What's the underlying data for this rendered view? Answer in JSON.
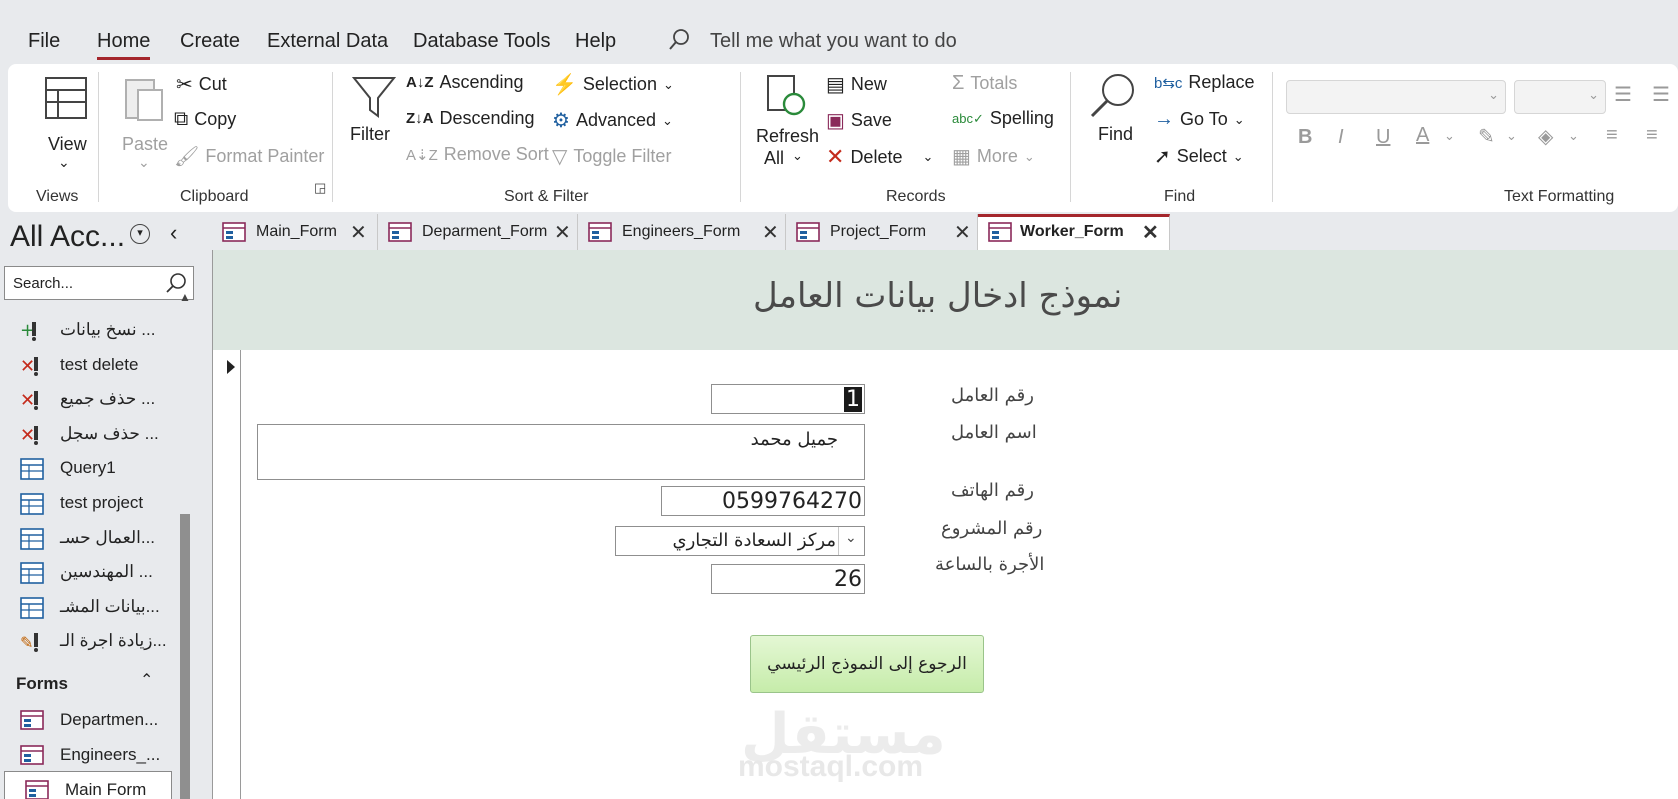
{
  "menu": {
    "items": [
      "File",
      "Home",
      "Create",
      "External Data",
      "Database Tools",
      "Help"
    ],
    "active": "Home",
    "tell_me": "Tell me what you want to do"
  },
  "ribbon": {
    "views": {
      "view": "View",
      "group": "Views"
    },
    "clipboard": {
      "paste": "Paste",
      "cut": "Cut",
      "copy": "Copy",
      "format_painter": "Format Painter",
      "group": "Clipboard"
    },
    "sort_filter": {
      "filter": "Filter",
      "ascending": "Ascending",
      "descending": "Descending",
      "remove_sort": "Remove Sort",
      "selection": "Selection",
      "advanced": "Advanced",
      "toggle_filter": "Toggle Filter",
      "group": "Sort & Filter"
    },
    "records": {
      "refresh": "Refresh",
      "refresh_all": "All",
      "new": "New",
      "save": "Save",
      "delete": "Delete",
      "totals": "Totals",
      "spelling": "Spelling",
      "more": "More",
      "group": "Records"
    },
    "find": {
      "find": "Find",
      "replace": "Replace",
      "go_to": "Go To",
      "select": "Select",
      "group": "Find"
    },
    "text_formatting": {
      "group": "Text Formatting"
    }
  },
  "nav": {
    "title": "All Acc...",
    "search_placeholder": "Search...",
    "items": [
      {
        "label": "نسخ بيانات ...",
        "icon": "append-query-icon"
      },
      {
        "label": "test delete",
        "icon": "delete-query-icon"
      },
      {
        "label": "حذف جميع ...",
        "icon": "delete-query-icon"
      },
      {
        "label": "حذف سجل ...",
        "icon": "delete-query-icon"
      },
      {
        "label": "Query1",
        "icon": "select-query-icon"
      },
      {
        "label": "test project",
        "icon": "select-query-icon"
      },
      {
        "label": "العمال حسـ...",
        "icon": "select-query-icon"
      },
      {
        "label": "المهندسين ...",
        "icon": "select-query-icon"
      },
      {
        "label": "بيانات المشـ...",
        "icon": "select-query-icon"
      },
      {
        "label": "زيادة اجرة الـ...",
        "icon": "update-query-icon"
      }
    ],
    "forms_section": "Forms",
    "forms": [
      "Departmen...",
      "Engineers_...",
      "Main Form"
    ]
  },
  "tabs": [
    {
      "label": "Main_Form",
      "active": false
    },
    {
      "label": "Deparment_Form",
      "active": false
    },
    {
      "label": "Engineers_Form",
      "active": false
    },
    {
      "label": "Project_Form",
      "active": false
    },
    {
      "label": "Worker_Form",
      "active": true
    }
  ],
  "form": {
    "title": "نموذج ادخال بيانات العامل",
    "fields": {
      "worker_id": {
        "label": "رقم العامل",
        "value": "1"
      },
      "worker_name": {
        "label": "اسم العامل",
        "value": "جميل محمد"
      },
      "phone": {
        "label": "رقم الهاتف",
        "value": "0599764270"
      },
      "project": {
        "label": "رقم المشروع",
        "value": "مركز السعادة التجاري"
      },
      "hourly_wage": {
        "label": "الأجرة بالساعة",
        "value": "26"
      }
    },
    "back_button": "الرجوع إلى النموذج الرئيسي"
  },
  "watermark": {
    "arabic": "مستقل",
    "latin": "mostaql.com"
  },
  "colors": {
    "accent": "#a4262c",
    "form_header": "#dce6e0",
    "button_green": "#c6ecaa"
  }
}
